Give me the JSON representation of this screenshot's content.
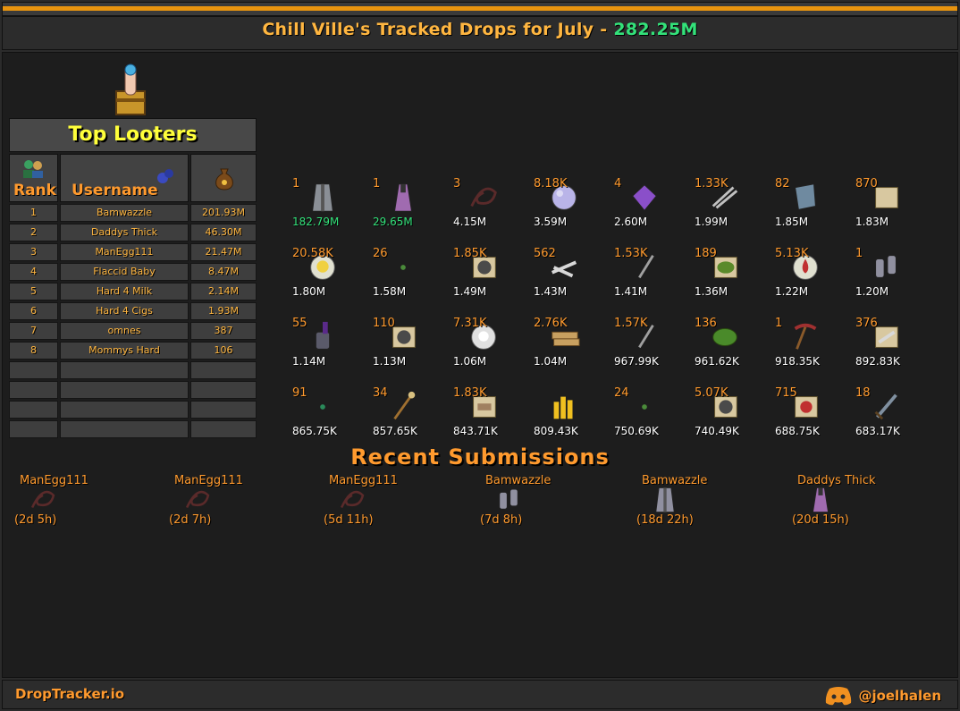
{
  "header": {
    "title_prefix": "Chill Ville's Tracked Drops for July - ",
    "total": "282.25M"
  },
  "top_looters": {
    "title": "Top Looters",
    "headers": {
      "rank": "Rank",
      "username": "Username"
    },
    "rows": [
      {
        "rank": "1",
        "username": "Bamwazzle",
        "value": "201.93M"
      },
      {
        "rank": "2",
        "username": "Daddys Thick",
        "value": "46.30M"
      },
      {
        "rank": "3",
        "username": "ManEgg111",
        "value": "21.47M"
      },
      {
        "rank": "4",
        "username": "Flaccid Baby",
        "value": "8.47M"
      },
      {
        "rank": "5",
        "username": "Hard 4 Milk",
        "value": "2.14M"
      },
      {
        "rank": "6",
        "username": "Hard 4 Cigs",
        "value": "1.93M"
      },
      {
        "rank": "7",
        "username": "omnes",
        "value": "387"
      },
      {
        "rank": "8",
        "username": "Mommys Hard",
        "value": "106"
      },
      {
        "rank": "",
        "username": "",
        "value": ""
      },
      {
        "rank": "",
        "username": "",
        "value": ""
      },
      {
        "rank": "",
        "username": "",
        "value": ""
      },
      {
        "rank": "",
        "username": "",
        "value": ""
      }
    ]
  },
  "items": [
    {
      "qty": "1",
      "value": "182.79M",
      "highlight": true,
      "icon": "robe-icon",
      "color": "#8a8f96"
    },
    {
      "qty": "1",
      "value": "29.65M",
      "highlight": true,
      "icon": "dress-icon",
      "color": "#a06bb0"
    },
    {
      "qty": "3",
      "value": "4.15M",
      "highlight": false,
      "icon": "whip-icon",
      "color": "#5a2a2a"
    },
    {
      "qty": "8.18K",
      "value": "3.59M",
      "highlight": false,
      "icon": "orb-icon",
      "color": "#b9b4e8"
    },
    {
      "qty": "4",
      "value": "2.60M",
      "highlight": false,
      "icon": "gem-icon",
      "color": "#8a4fc9"
    },
    {
      "qty": "1.33K",
      "value": "1.99M",
      "highlight": false,
      "icon": "bolts-icon",
      "color": "#c0c0c0"
    },
    {
      "qty": "82",
      "value": "1.85M",
      "highlight": false,
      "icon": "shield-icon",
      "color": "#6f8aa0"
    },
    {
      "qty": "870",
      "value": "1.83M",
      "highlight": false,
      "icon": "scroll-icon",
      "color": "#d8c8a0"
    },
    {
      "qty": "20.58K",
      "value": "1.80M",
      "highlight": false,
      "icon": "rune-icon",
      "color": "#f0d040"
    },
    {
      "qty": "26",
      "value": "1.58M",
      "highlight": false,
      "icon": "seed-icon",
      "color": "#4a8a3a"
    },
    {
      "qty": "1.85K",
      "value": "1.49M",
      "highlight": false,
      "icon": "note-icon",
      "color": "#4a4a4a"
    },
    {
      "qty": "562",
      "value": "1.43M",
      "highlight": false,
      "icon": "bones-icon",
      "color": "#d8d8d8"
    },
    {
      "qty": "1.53K",
      "value": "1.41M",
      "highlight": false,
      "icon": "dart-icon",
      "color": "#a0a0a0"
    },
    {
      "qty": "189",
      "value": "1.36M",
      "highlight": false,
      "icon": "herb-note-icon",
      "color": "#5a8a2a"
    },
    {
      "qty": "5.13K",
      "value": "1.22M",
      "highlight": false,
      "icon": "blood-rune-icon",
      "color": "#c03030"
    },
    {
      "qty": "1",
      "value": "1.20M",
      "highlight": false,
      "icon": "gauntlet-icon",
      "color": "#9090a0"
    },
    {
      "qty": "55",
      "value": "1.14M",
      "highlight": false,
      "icon": "glove-icon",
      "color": "#5a5a6a"
    },
    {
      "qty": "110",
      "value": "1.13M",
      "highlight": false,
      "icon": "note-icon",
      "color": "#4a4a4a"
    },
    {
      "qty": "7.31K",
      "value": "1.06M",
      "highlight": false,
      "icon": "death-rune-icon",
      "color": "#e0e0e0"
    },
    {
      "qty": "2.76K",
      "value": "1.04M",
      "highlight": false,
      "icon": "planks-icon",
      "color": "#c8a060"
    },
    {
      "qty": "1.57K",
      "value": "967.99K",
      "highlight": false,
      "icon": "dart-icon",
      "color": "#a0a0a0"
    },
    {
      "qty": "136",
      "value": "961.62K",
      "highlight": false,
      "icon": "herb-icon",
      "color": "#4a8a2a"
    },
    {
      "qty": "1",
      "value": "918.35K",
      "highlight": false,
      "icon": "pickaxe-icon",
      "color": "#a03030"
    },
    {
      "qty": "376",
      "value": "892.83K",
      "highlight": false,
      "icon": "bones-note-icon",
      "color": "#d8d8d8"
    },
    {
      "qty": "91",
      "value": "865.75K",
      "highlight": false,
      "icon": "seed-icon",
      "color": "#2a8a5a"
    },
    {
      "qty": "34",
      "value": "857.65K",
      "highlight": false,
      "icon": "staff-icon",
      "color": "#d8c080"
    },
    {
      "qty": "1.83K",
      "value": "843.71K",
      "highlight": false,
      "icon": "log-note-icon",
      "color": "#a08060"
    },
    {
      "qty": "",
      "value": "809.43K",
      "highlight": false,
      "icon": "coins-icon",
      "color": "#f0c020"
    },
    {
      "qty": "24",
      "value": "750.69K",
      "highlight": false,
      "icon": "seed-icon",
      "color": "#4a8a3a"
    },
    {
      "qty": "5.07K",
      "value": "740.49K",
      "highlight": false,
      "icon": "note-icon",
      "color": "#4a4a4a"
    },
    {
      "qty": "715",
      "value": "688.75K",
      "highlight": false,
      "icon": "blood-note-icon",
      "color": "#c03030"
    },
    {
      "qty": "18",
      "value": "683.17K",
      "highlight": false,
      "icon": "sword-icon",
      "color": "#8090a0"
    }
  ],
  "recent": {
    "title": "Recent Submissions",
    "entries": [
      {
        "name": "ManEgg111",
        "ago": "(2d 5h)",
        "icon": "whip-icon"
      },
      {
        "name": "ManEgg111",
        "ago": "(2d 7h)",
        "icon": "whip-icon"
      },
      {
        "name": "ManEgg111",
        "ago": "(5d 11h)",
        "icon": "whip-icon"
      },
      {
        "name": "Bamwazzle",
        "ago": "(7d 8h)",
        "icon": "gauntlet-icon"
      },
      {
        "name": "Bamwazzle",
        "ago": "(18d 22h)",
        "icon": "robe-icon"
      },
      {
        "name": "Daddys Thick",
        "ago": "(20d 15h)",
        "icon": "dress-icon"
      }
    ]
  },
  "footer": {
    "brand": "DropTracker.io",
    "handle": "@joelhalen"
  }
}
